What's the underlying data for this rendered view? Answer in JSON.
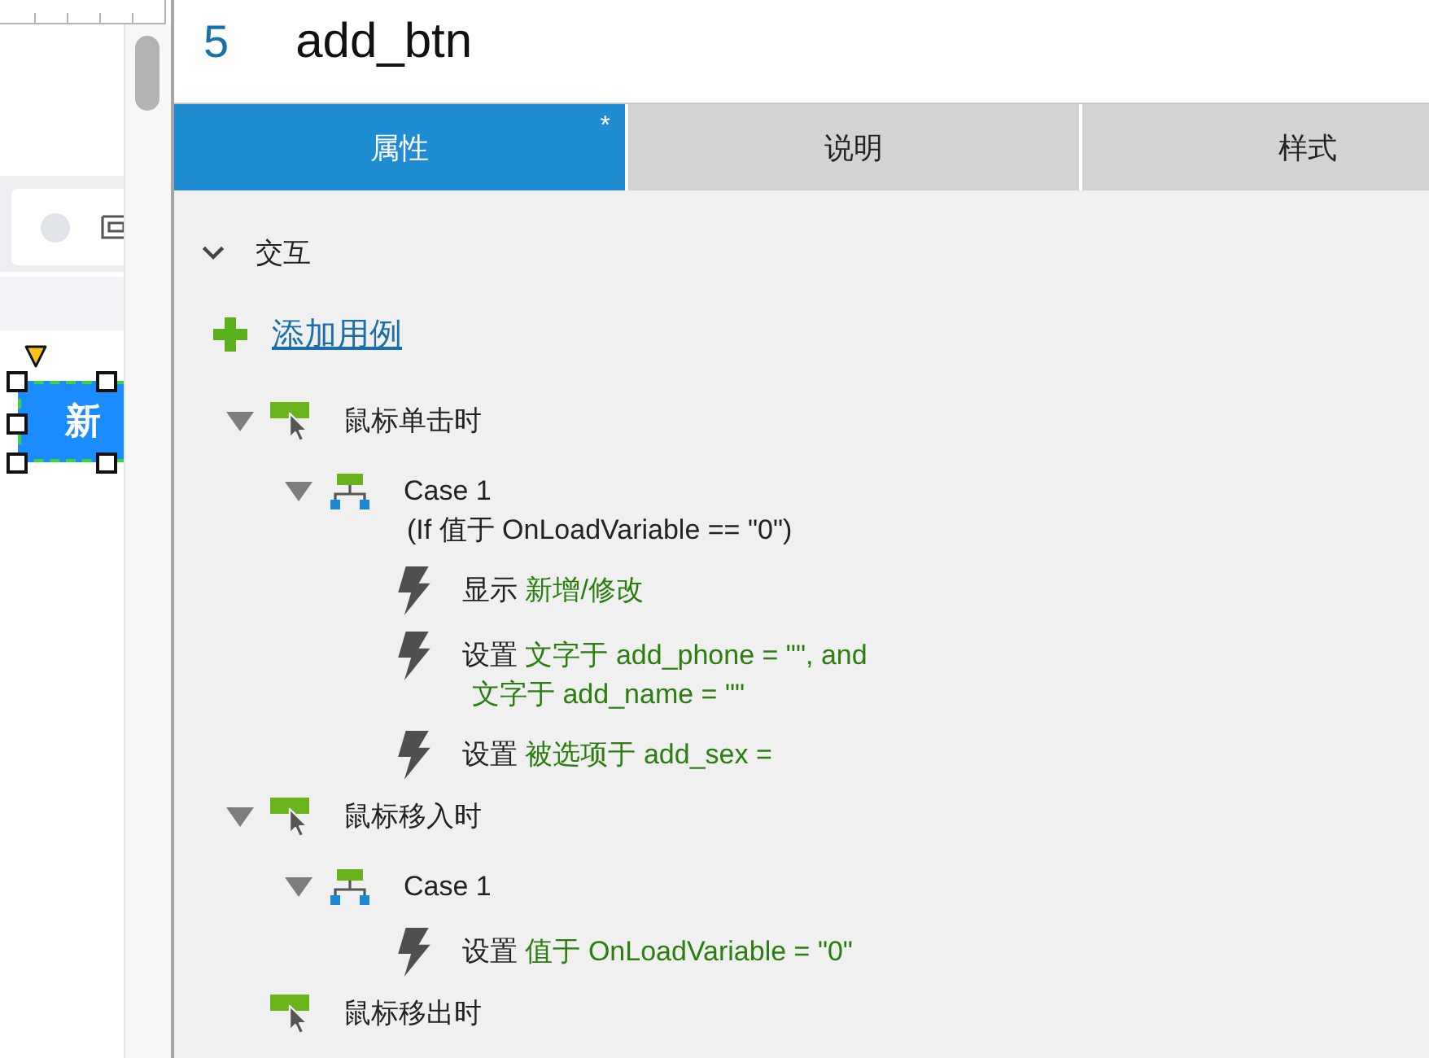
{
  "canvas": {
    "widget": {
      "label": "新",
      "selected": true
    }
  },
  "inspector": {
    "number": "5",
    "name": "add_btn"
  },
  "tabs": [
    {
      "label": "属性",
      "selected": true,
      "marker": "*"
    },
    {
      "label": "说明",
      "selected": false
    },
    {
      "label": "样式",
      "selected": false
    }
  ],
  "interactions": {
    "title": "交互",
    "expanded": true,
    "add_case": "添加用例",
    "events": [
      {
        "label": "鼠标单击时",
        "cases": [
          {
            "label": "Case 1",
            "condition": "(If 值于 OnLoadVariable == \"0\")",
            "actions": [
              {
                "verb": "显示",
                "target": [
                  "新增/修改"
                ]
              },
              {
                "verb": "设置",
                "target": [
                  "文字于 add_phone = \"\", and",
                  "文字于 add_name = \"\""
                ]
              },
              {
                "verb": "设置",
                "target": [
                  "被选项于 add_sex ="
                ]
              }
            ]
          }
        ]
      },
      {
        "label": "鼠标移入时",
        "cases": [
          {
            "label": "Case 1",
            "actions": [
              {
                "verb": "设置",
                "target": [
                  "值于 OnLoadVariable = \"0\""
                ]
              }
            ]
          }
        ]
      },
      {
        "label": "鼠标移出时"
      }
    ]
  }
}
